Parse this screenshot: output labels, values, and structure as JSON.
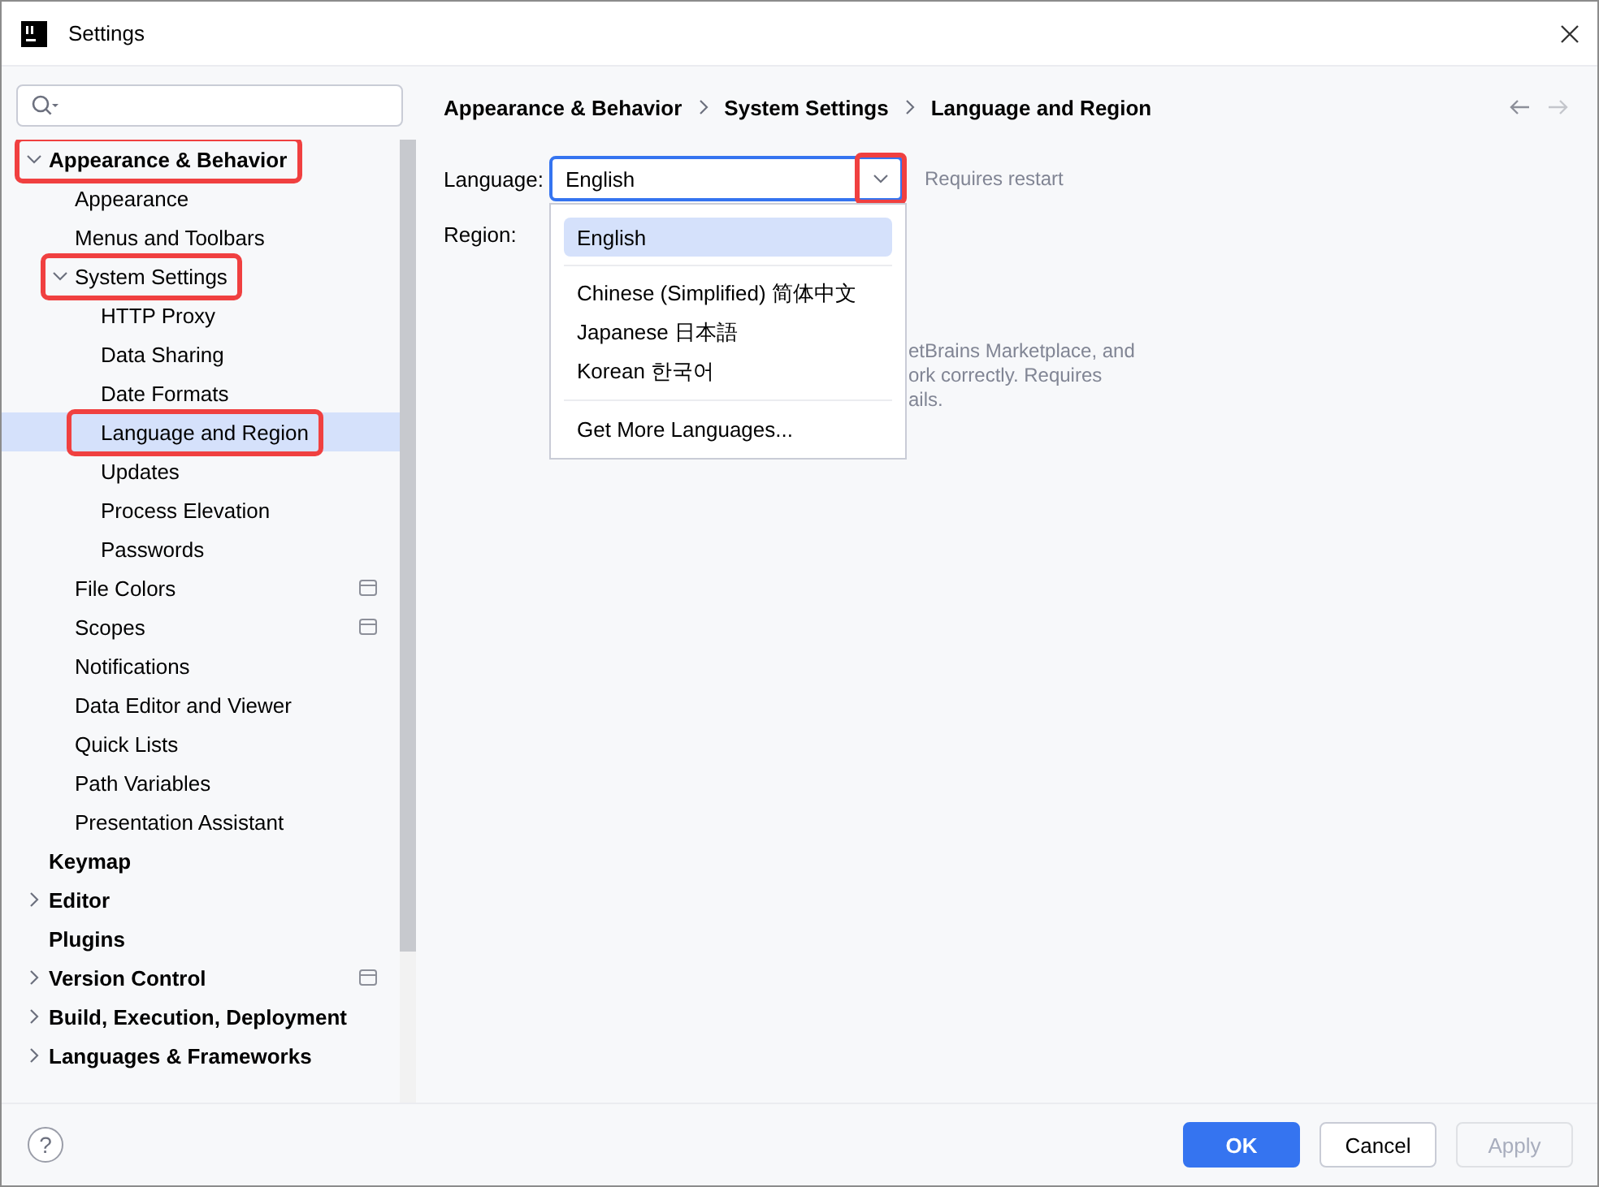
{
  "window": {
    "title": "Settings"
  },
  "tree": [
    {
      "label": "Appearance & Behavior",
      "bold": true,
      "expanded": true,
      "selected": false,
      "highlighted": true,
      "children": [
        {
          "label": "Appearance",
          "selected": false,
          "highlighted": false
        },
        {
          "label": "Menus and Toolbars",
          "selected": false,
          "highlighted": false
        },
        {
          "label": "System Settings",
          "expanded": true,
          "selected": false,
          "highlighted": true,
          "children": [
            {
              "label": "HTTP Proxy",
              "selected": false,
              "highlighted": false
            },
            {
              "label": "Data Sharing",
              "selected": false,
              "highlighted": false
            },
            {
              "label": "Date Formats",
              "selected": false,
              "highlighted": false
            },
            {
              "label": "Language and Region",
              "selected": true,
              "highlighted": true
            },
            {
              "label": "Updates",
              "selected": false,
              "highlighted": false
            },
            {
              "label": "Process Elevation",
              "selected": false,
              "highlighted": false
            },
            {
              "label": "Passwords",
              "selected": false,
              "highlighted": false
            }
          ]
        },
        {
          "label": "File Colors",
          "selected": false,
          "highlighted": false,
          "project_level": true
        },
        {
          "label": "Scopes",
          "selected": false,
          "highlighted": false,
          "project_level": true
        },
        {
          "label": "Notifications",
          "selected": false,
          "highlighted": false
        },
        {
          "label": "Data Editor and Viewer",
          "selected": false,
          "highlighted": false
        },
        {
          "label": "Quick Lists",
          "selected": false,
          "highlighted": false
        },
        {
          "label": "Path Variables",
          "selected": false,
          "highlighted": false
        },
        {
          "label": "Presentation Assistant",
          "selected": false,
          "highlighted": false
        }
      ]
    },
    {
      "label": "Keymap",
      "bold": true,
      "selected": false,
      "highlighted": false
    },
    {
      "label": "Editor",
      "bold": true,
      "expanded": false,
      "selected": false,
      "highlighted": false
    },
    {
      "label": "Plugins",
      "bold": true,
      "selected": false,
      "highlighted": false
    },
    {
      "label": "Version Control",
      "bold": true,
      "expanded": false,
      "selected": false,
      "highlighted": false,
      "project_level": true
    },
    {
      "label": "Build, Execution, Deployment",
      "bold": true,
      "expanded": false,
      "selected": false,
      "highlighted": false
    },
    {
      "label": "Languages & Frameworks",
      "bold": true,
      "expanded": false,
      "selected": false,
      "highlighted": false
    }
  ],
  "breadcrumb": [
    "Appearance & Behavior",
    "System Settings",
    "Language and Region"
  ],
  "language": {
    "label": "Language:",
    "value": "English",
    "arrow_highlighted": true,
    "note": "Requires restart"
  },
  "region": {
    "label": "Region:"
  },
  "hint_fragments": [
    "etBrains Marketplace, and",
    "ork correctly. Requires",
    "ails."
  ],
  "dropdown": {
    "options": [
      {
        "label": "English",
        "selected": true
      },
      {
        "label": "Chinese (Simplified) 简体中文",
        "selected": false
      },
      {
        "label": "Japanese 日本語",
        "selected": false
      },
      {
        "label": "Korean 한국어",
        "selected": false
      }
    ],
    "action": "Get More Languages..."
  },
  "help": "?",
  "buttons": [
    {
      "label": "OK",
      "kind": "primary",
      "disabled": false
    },
    {
      "label": "Cancel",
      "kind": "secondary",
      "disabled": false
    },
    {
      "label": "Apply",
      "kind": "secondary",
      "disabled": true
    }
  ]
}
